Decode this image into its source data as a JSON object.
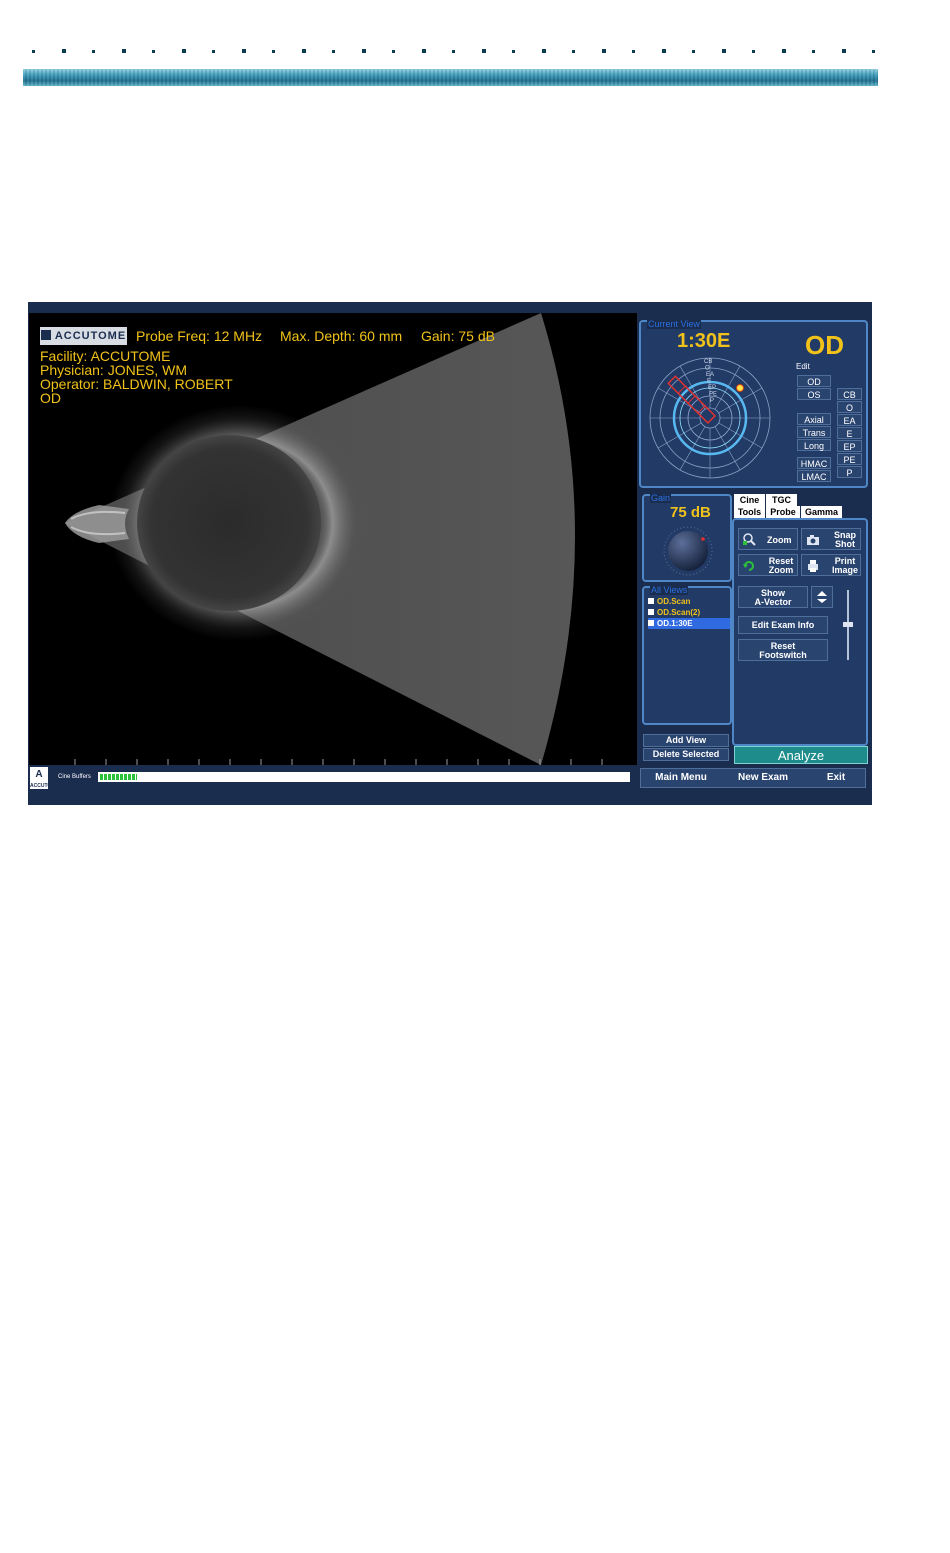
{
  "scan_header": {
    "logo": "ACCUTOME",
    "probe_freq": "Probe Freq: 12 MHz",
    "max_depth": "Max. Depth: 60 mm",
    "gain": "Gain: 75 dB",
    "facility": "Facility: ACCUTOME",
    "physician": "Physician: JONES, WM",
    "operator": "Operator: BALDWIN, ROBERT",
    "eye": "OD"
  },
  "cine": {
    "label": "Cine Buffers",
    "fill_fraction": 0.07
  },
  "current_view": {
    "title": "Current View",
    "clock": "1:30E",
    "eye": "OD",
    "edit_label": "Edit",
    "eye_buttons": [
      "OD",
      "OS"
    ],
    "orientation_buttons": [
      "Axial",
      "Trans",
      "Long"
    ],
    "mac_buttons": [
      "HMAC",
      "LMAC"
    ],
    "zone_buttons": [
      "CB",
      "O",
      "EA",
      "E",
      "EP",
      "PE",
      "P"
    ],
    "dial_labels": [
      "CB",
      "O",
      "EA",
      "E",
      "EP",
      "PE",
      "P"
    ]
  },
  "gain_panel": {
    "title": "Gain",
    "value": "75 dB"
  },
  "all_views": {
    "title": "All Views",
    "items": [
      {
        "label": "OD.Scan",
        "selected": false
      },
      {
        "label": "OD.Scan(2)",
        "selected": false
      },
      {
        "label": "OD.1:30E",
        "selected": true
      }
    ],
    "add_view": "Add View",
    "delete_selected": "Delete Selected"
  },
  "tabs": {
    "top": [
      "Cine",
      "TGC"
    ],
    "bottom": [
      "Tools",
      "Probe",
      "Gamma"
    ],
    "active": "Tools"
  },
  "tools": {
    "zoom": "Zoom",
    "snap_shot": [
      "Snap",
      "Shot"
    ],
    "reset_zoom": [
      "Reset",
      "Zoom"
    ],
    "print_image": [
      "Print",
      "Image"
    ],
    "show_a_vector": [
      "Show",
      "A-Vector"
    ],
    "edit_exam_info": "Edit Exam Info",
    "reset_footswitch": [
      "Reset",
      "Footswitch"
    ]
  },
  "analyze": "Analyze",
  "bottom_nav": {
    "main_menu": "Main Menu",
    "new_exam": "New Exam",
    "exit": "Exit"
  },
  "colors": {
    "app_bg": "#1b2d4f",
    "panel_border": "#4f87c6",
    "accent_yellow": "#f1c21a",
    "analyze_teal": "#1f8c8c",
    "selected_blue": "#2f6ae0",
    "cine_green": "#2bc23a"
  }
}
